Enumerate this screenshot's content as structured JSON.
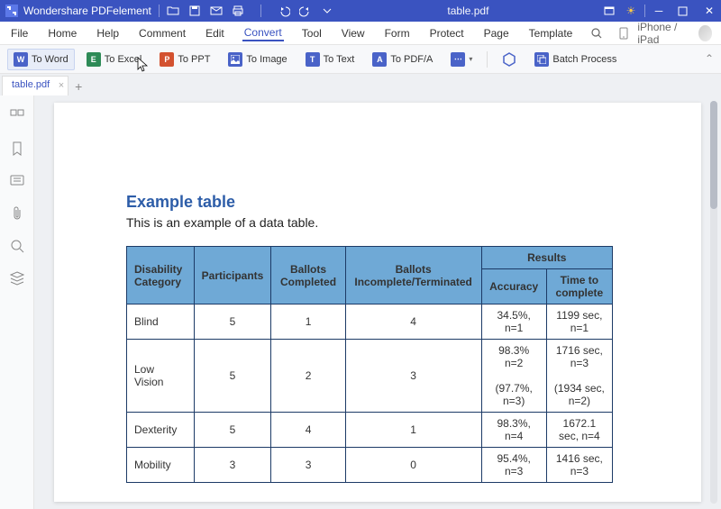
{
  "app": {
    "name": "Wondershare PDFelement",
    "docTitle": "table.pdf"
  },
  "menu": {
    "items": [
      "File",
      "Home",
      "Help",
      "Comment",
      "Edit",
      "Convert",
      "Tool",
      "View",
      "Form",
      "Protect",
      "Page",
      "Template"
    ],
    "activeIndex": 5,
    "iphone": "iPhone / iPad"
  },
  "ribbon": {
    "toWord": "To Word",
    "toExcel": "To Excel",
    "toPPT": "To PPT",
    "toImage": "To Image",
    "toText": "To Text",
    "toPDFA": "To PDF/A",
    "batch": "Batch Process"
  },
  "tab": {
    "name": "table.pdf"
  },
  "document": {
    "heading": "Example table",
    "intro": "This is an example of a data table.",
    "headers": {
      "c0": "Disability Category",
      "c1": "Participants",
      "c2": "Ballots Completed",
      "c3": "Ballots Incomplete/Terminated",
      "results": "Results",
      "accuracy": "Accuracy",
      "time": "Time to complete"
    },
    "rows": [
      {
        "cat": "Blind",
        "part": "5",
        "bc": "1",
        "bi": "4",
        "acc": "34.5%, n=1",
        "time": "1199 sec, n=1",
        "acc2": "",
        "time2": ""
      },
      {
        "cat": "Low Vision",
        "part": "5",
        "bc": "2",
        "bi": "3",
        "acc": "98.3% n=2",
        "time": "1716 sec, n=3",
        "acc2": "(97.7%, n=3)",
        "time2": "(1934 sec, n=2)"
      },
      {
        "cat": "Dexterity",
        "part": "5",
        "bc": "4",
        "bi": "1",
        "acc": "98.3%, n=4",
        "time": "1672.1 sec, n=4",
        "acc2": "",
        "time2": ""
      },
      {
        "cat": "Mobility",
        "part": "3",
        "bc": "3",
        "bi": "0",
        "acc": "95.4%, n=3",
        "time": "1416 sec, n=3",
        "acc2": "",
        "time2": ""
      }
    ]
  }
}
